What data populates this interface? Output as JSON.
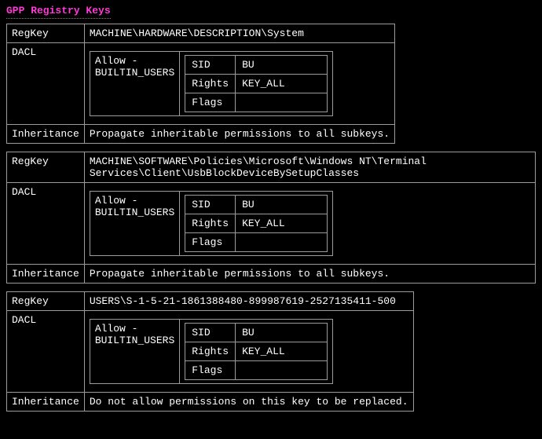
{
  "title": "GPP Registry Keys",
  "labels": {
    "regkey": "RegKey",
    "dacl": "DACL",
    "inheritance": "Inheritance",
    "allow_builtin_users": "Allow -\nBUILTIN_USERS",
    "sid": "SID",
    "rights": "Rights",
    "flags": "Flags"
  },
  "entries": [
    {
      "regkey": "MACHINE\\HARDWARE\\DESCRIPTION\\System",
      "dacl": {
        "sid": "BU",
        "rights": "KEY_ALL",
        "flags": ""
      },
      "inheritance": "Propagate inheritable permissions to all subkeys."
    },
    {
      "regkey": "MACHINE\\SOFTWARE\\Policies\\Microsoft\\Windows NT\\Terminal Services\\Client\\UsbBlockDeviceBySetupClasses",
      "dacl": {
        "sid": "BU",
        "rights": "KEY_ALL",
        "flags": ""
      },
      "inheritance": "Propagate inheritable permissions to all subkeys."
    },
    {
      "regkey": "USERS\\S-1-5-21-1861388480-899987619-2527135411-500",
      "dacl": {
        "sid": "BU",
        "rights": "KEY_ALL",
        "flags": ""
      },
      "inheritance": "Do not allow permissions on this key to be replaced."
    }
  ]
}
